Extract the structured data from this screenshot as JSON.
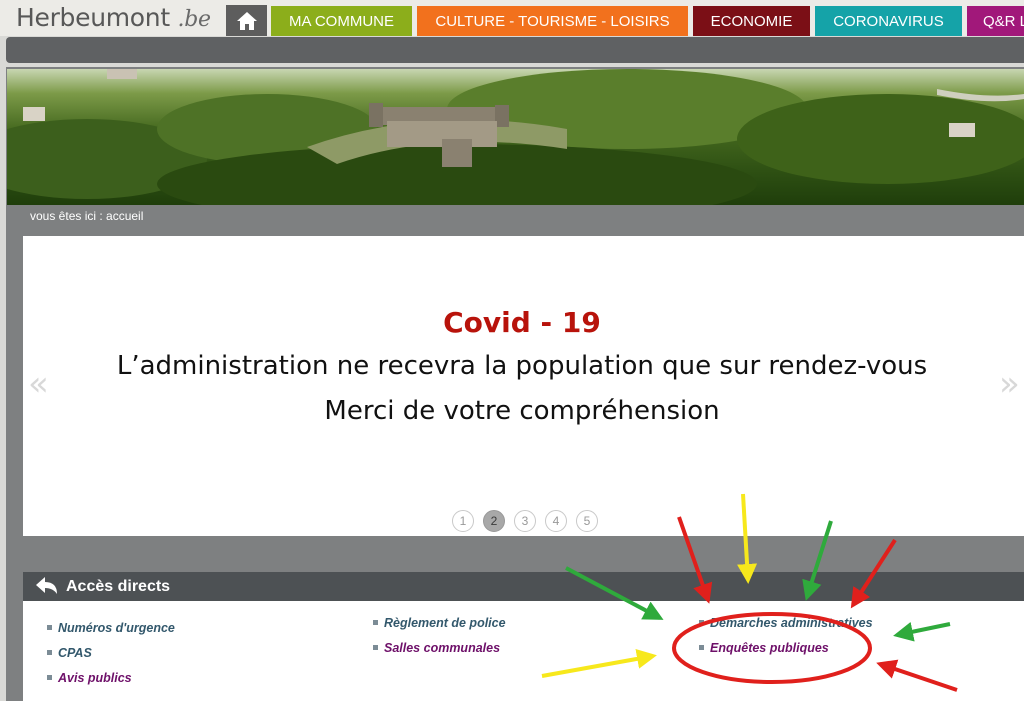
{
  "site": {
    "logo_name": "Herbeumont",
    "logo_ext": ".be"
  },
  "nav": {
    "tabs": [
      {
        "label": "MA COMMUNE",
        "color": "#8cae1b"
      },
      {
        "label": "CULTURE - TOURISME - LOISIRS",
        "color": "#f2711d"
      },
      {
        "label": "ECONOMIE",
        "color": "#7b0f16"
      },
      {
        "label": "CORONAVIRUS",
        "color": "#15a3a8"
      },
      {
        "label": "Q&R L",
        "color": "#a1187a"
      }
    ],
    "home_icon": "home-icon"
  },
  "breadcrumb": "vous êtes ici : accueil",
  "slider": {
    "title": "Covid - 19",
    "line1": "L’administration ne recevra la population que sur rendez-vous",
    "line2": "Merci de votre compréhension",
    "prev_symbol": "«",
    "next_symbol": "»",
    "pages": [
      "1",
      "2",
      "3",
      "4",
      "5"
    ],
    "active_page": "2"
  },
  "acces": {
    "title": "Accès directs",
    "icon": "curved-arrow-icon",
    "links": [
      {
        "label": "Numéros d'urgence",
        "color": "#33586c"
      },
      {
        "label": "CPAS",
        "color": "#33586c"
      },
      {
        "label": "Avis publics",
        "color": "#6e1069"
      },
      {
        "label": "Règlement de police",
        "color": "#33586c"
      },
      {
        "label": "Salles communales",
        "color": "#6e1069"
      },
      {
        "label": "Démarches administratives",
        "color": "#33586c"
      },
      {
        "label": "Enquêtes publiques",
        "color": "#6e1069"
      }
    ]
  },
  "annotation_colors": {
    "red": "#e0201c",
    "yellow": "#f7e81c",
    "green": "#2faa3c"
  }
}
